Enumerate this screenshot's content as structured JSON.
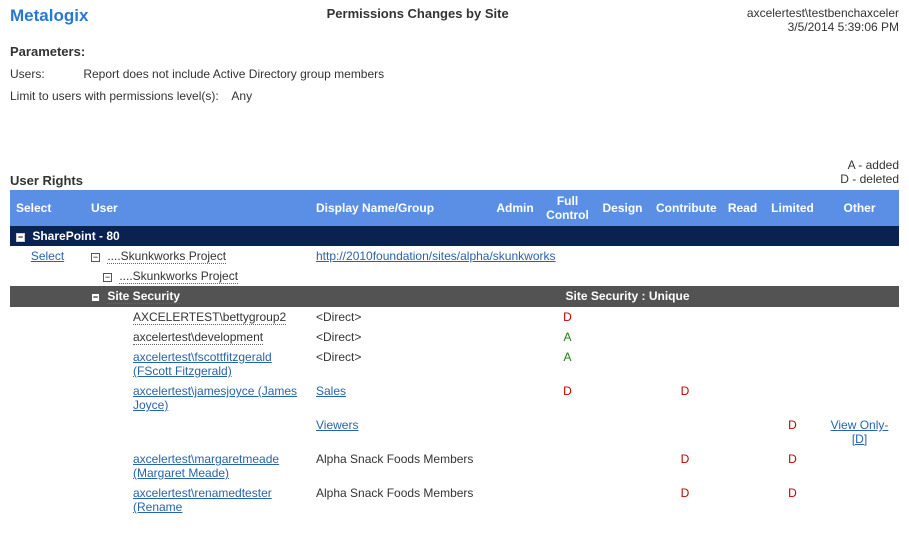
{
  "header": {
    "logo": "Metalogix",
    "title": "Permissions Changes by Site",
    "user": "axcelertest\\testbenchaxceler",
    "timestamp": "3/5/2014 5:39:06 PM"
  },
  "params": {
    "heading": "Parameters:",
    "users_label": "Users:",
    "users_value": "Report does not include Active Directory group members",
    "level_label": "Limit to users with permissions level(s):",
    "level_value": "Any"
  },
  "rights_heading": "User Rights",
  "legend": {
    "added": "A - added",
    "deleted": "D - deleted"
  },
  "columns": [
    "Select",
    "User",
    "Display Name/Group",
    "Admin",
    "Full Control",
    "Design",
    "Contribute",
    "Read",
    "Limited",
    "Other"
  ],
  "site_header": "SharePoint - 80",
  "select_label": "Select",
  "project": {
    "row1_label": "....Skunkworks Project",
    "row1_url": "http://2010foundation/sites/alpha/skunkworks",
    "row2_label": "....Skunkworks Project"
  },
  "section": {
    "left": "Site Security",
    "right": "Site Security : Unique"
  },
  "rows": [
    {
      "user": "AXCELERTEST\\bettygroup2",
      "user_link": false,
      "display": "<Direct>",
      "display_link": false,
      "marks": {
        "full": "D"
      }
    },
    {
      "user": "axcelertest\\development",
      "user_link": false,
      "display": "<Direct>",
      "display_link": false,
      "marks": {
        "full": "A"
      }
    },
    {
      "user": "axcelertest\\fscottfitzgerald (FScott Fitzgerald)",
      "user_link": true,
      "display": "<Direct>",
      "display_link": false,
      "marks": {
        "full": "A"
      }
    },
    {
      "user": "axcelertest\\jamesjoyce (James Joyce)",
      "user_link": true,
      "display": "Sales",
      "display_link": true,
      "marks": {
        "full": "D",
        "contribute": "D"
      }
    },
    {
      "user": "",
      "user_link": false,
      "display": "Viewers",
      "display_link": true,
      "marks": {
        "limited": "D"
      },
      "other": "View Only-[D]",
      "other_link": true
    },
    {
      "user": "axcelertest\\margaretmeade (Margaret Meade)",
      "user_link": true,
      "display": "Alpha Snack Foods Members",
      "display_link": false,
      "marks": {
        "contribute": "D",
        "limited": "D"
      }
    },
    {
      "user": "axcelertest\\renamedtester (Rename",
      "user_link": true,
      "display": "Alpha Snack Foods Members",
      "display_link": false,
      "marks": {
        "contribute": "D",
        "limited": "D"
      }
    }
  ]
}
